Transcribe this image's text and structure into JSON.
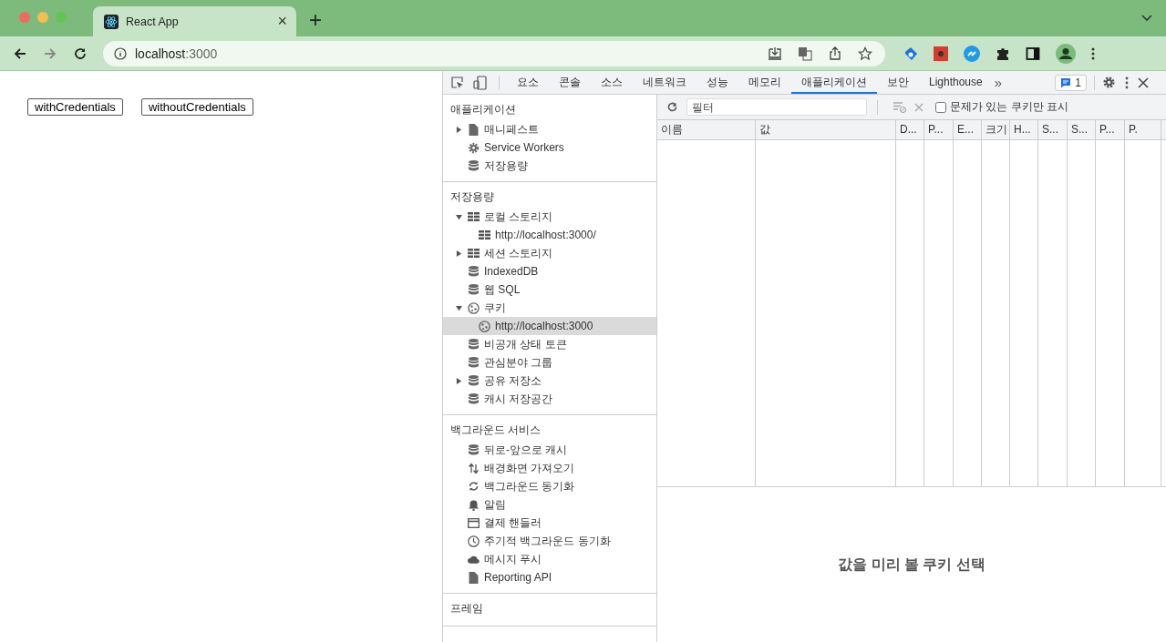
{
  "browser": {
    "tab": {
      "title": "React App",
      "close": "×"
    },
    "new_tab": "+",
    "address": {
      "host": "localhost",
      "port": ":3000"
    }
  },
  "page": {
    "buttons": [
      "withCredentials",
      "withoutCredentials"
    ]
  },
  "devtools": {
    "tabs": [
      {
        "label": "요소",
        "selected": false
      },
      {
        "label": "콘솔",
        "selected": false
      },
      {
        "label": "소스",
        "selected": false
      },
      {
        "label": "네트워크",
        "selected": false
      },
      {
        "label": "성능",
        "selected": false
      },
      {
        "label": "메모리",
        "selected": false
      },
      {
        "label": "애플리케이션",
        "selected": true
      },
      {
        "label": "보안",
        "selected": false
      },
      {
        "label": "Lighthouse",
        "selected": false
      }
    ],
    "more_tabs": "»",
    "issues_badge": "1",
    "sidebar": {
      "sections": [
        {
          "title": "애플리케이션",
          "items": [
            {
              "label": "매니페스트",
              "kind": "file",
              "expanded": false,
              "selected": false
            },
            {
              "label": "Service Workers",
              "kind": "gear",
              "selected": false
            },
            {
              "label": "저장용량",
              "kind": "database",
              "selected": false
            }
          ]
        },
        {
          "title": "저장용량",
          "items": [
            {
              "label": "로컬 스토리지",
              "kind": "grid",
              "expanded": true,
              "selected": false,
              "children": [
                {
                  "label": "http://localhost:3000/",
                  "kind": "grid",
                  "selected": false
                }
              ]
            },
            {
              "label": "세션 스토리지",
              "kind": "grid",
              "expanded": false,
              "selected": false
            },
            {
              "label": "IndexedDB",
              "kind": "database",
              "selected": false
            },
            {
              "label": "웹 SQL",
              "kind": "database",
              "selected": false
            },
            {
              "label": "쿠키",
              "kind": "cookie",
              "expanded": true,
              "selected": false,
              "children": [
                {
                  "label": "http://localhost:3000",
                  "kind": "cookie",
                  "selected": true
                }
              ]
            },
            {
              "label": "비공개 상태 토큰",
              "kind": "database",
              "selected": false
            },
            {
              "label": "관심분야 그룹",
              "kind": "database",
              "selected": false
            },
            {
              "label": "공유 저장소",
              "kind": "database",
              "expanded": false,
              "selected": false
            },
            {
              "label": "캐시 저장공간",
              "kind": "database",
              "selected": false
            }
          ]
        },
        {
          "title": "백그라운드 서비스",
          "items": [
            {
              "label": "뒤로-앞으로 캐시",
              "kind": "database",
              "selected": false
            },
            {
              "label": "배경화면 가져오기",
              "kind": "arrows",
              "selected": false
            },
            {
              "label": "백그라운드 동기화",
              "kind": "sync",
              "selected": false
            },
            {
              "label": "알림",
              "kind": "bell",
              "selected": false
            },
            {
              "label": "결제 핸들러",
              "kind": "card",
              "selected": false
            },
            {
              "label": "주기적 백그라운드 동기화",
              "kind": "clock",
              "selected": false
            },
            {
              "label": "메시지 푸시",
              "kind": "cloud",
              "selected": false
            },
            {
              "label": "Reporting API",
              "kind": "file",
              "selected": false
            }
          ]
        },
        {
          "title": "프레임"
        }
      ]
    },
    "cookies": {
      "filter": {
        "placeholder": "필터"
      },
      "only_issues": {
        "label": "문제가 있는 쿠키만 표시",
        "checked": false
      },
      "columns": [
        "이름",
        "값",
        "D...",
        "P...",
        "E...",
        "크기",
        "H...",
        "S...",
        "S...",
        "P...",
        "P."
      ],
      "preview": "값을 미리 볼 쿠키 선택"
    }
  }
}
